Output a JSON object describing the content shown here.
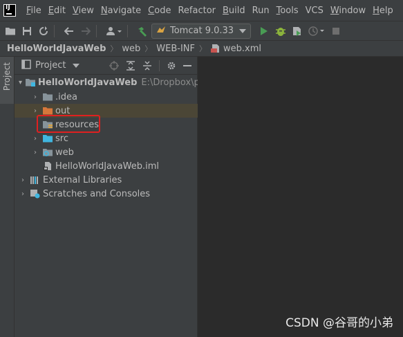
{
  "menubar": {
    "items": [
      {
        "mn": "F",
        "rest": "ile"
      },
      {
        "mn": "E",
        "rest": "dit"
      },
      {
        "mn": "V",
        "rest": "iew"
      },
      {
        "mn": "N",
        "rest": "avigate"
      },
      {
        "mn": "C",
        "rest": "ode"
      },
      {
        "mn": "",
        "rest": "Refactor"
      },
      {
        "mn": "B",
        "rest": "uild"
      },
      {
        "mn": "",
        "rest": "Run"
      },
      {
        "mn": "T",
        "rest": "ools"
      },
      {
        "mn": "",
        "rest": "VCS"
      },
      {
        "mn": "W",
        "rest": "indow"
      },
      {
        "mn": "H",
        "rest": "elp"
      }
    ]
  },
  "toolbar": {
    "run_config": "Tomcat 9.0.33",
    "colors": {
      "run": "#499c54",
      "debug": "#8bb33c",
      "stop": "#6e6e6e"
    }
  },
  "breadcrumb": {
    "project": "HelloWorldJavaWeb",
    "web": "web",
    "webinf": "WEB-INF",
    "file": "web.xml"
  },
  "stripe": {
    "label": "Project"
  },
  "panel": {
    "title": "Project"
  },
  "tree": {
    "root": {
      "label": "HelloWorldJavaWeb",
      "path": "E:\\Dropbox\\pho"
    },
    "idea": ".idea",
    "out": "out",
    "resources": "resources",
    "src": "src",
    "web": "web",
    "iml": "HelloWorldJavaWeb.iml",
    "ext": "External Libraries",
    "scratch": "Scratches and Consoles"
  },
  "watermark": "CSDN @谷哥的小弟"
}
